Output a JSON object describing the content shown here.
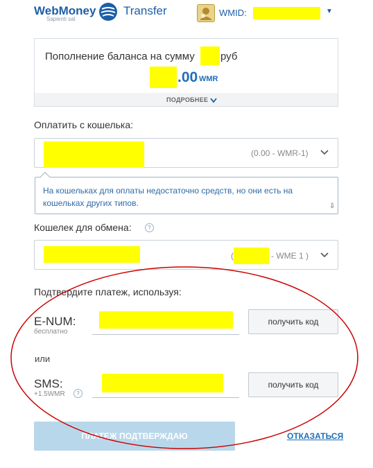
{
  "header": {
    "brand": "WebMoney",
    "tagline": "Sapienti sat",
    "product": "Transfer",
    "wmid_label": "WMID:",
    "icons": {
      "globe": "webmoney-globe-icon",
      "avatar": "user-avatar-icon",
      "caret": "chevron-down-icon"
    }
  },
  "summary": {
    "title": "Пополнение баланса на сумму",
    "unit": "руб",
    "amount_decimals": ".00",
    "amount_currency": "WMR",
    "details_link": "ПОДРОБНЕЕ"
  },
  "pay_from": {
    "label": "Оплатить с кошелька:",
    "range": "(0.00 - WMR-1)"
  },
  "notice": {
    "text": "На кошельках для оплаты недостаточно средств, но они есть на кошельках других типов."
  },
  "exchange": {
    "label": "Кошелек для обмена:",
    "range_open": "(",
    "range_suffix": "- WME 1 )"
  },
  "confirm_section": {
    "title": "Подтвердите платеж, используя:",
    "enum_label": "E-NUM:",
    "enum_sub": "бесплатно",
    "or": "или",
    "sms_label": "SMS:",
    "sms_sub": "+1.5WMR",
    "get_code": "получить код"
  },
  "actions": {
    "confirm": "ПЛАТЕЖ ПОДТВЕРЖДАЮ",
    "cancel": "ОТКАЗАТЬСЯ"
  },
  "colors": {
    "brand_blue": "#1d5ea8",
    "link_blue": "#1d6fb8",
    "redaction": "#ffff00",
    "annotation_red": "#cc0000",
    "confirm_disabled": "#b9d7ea"
  }
}
